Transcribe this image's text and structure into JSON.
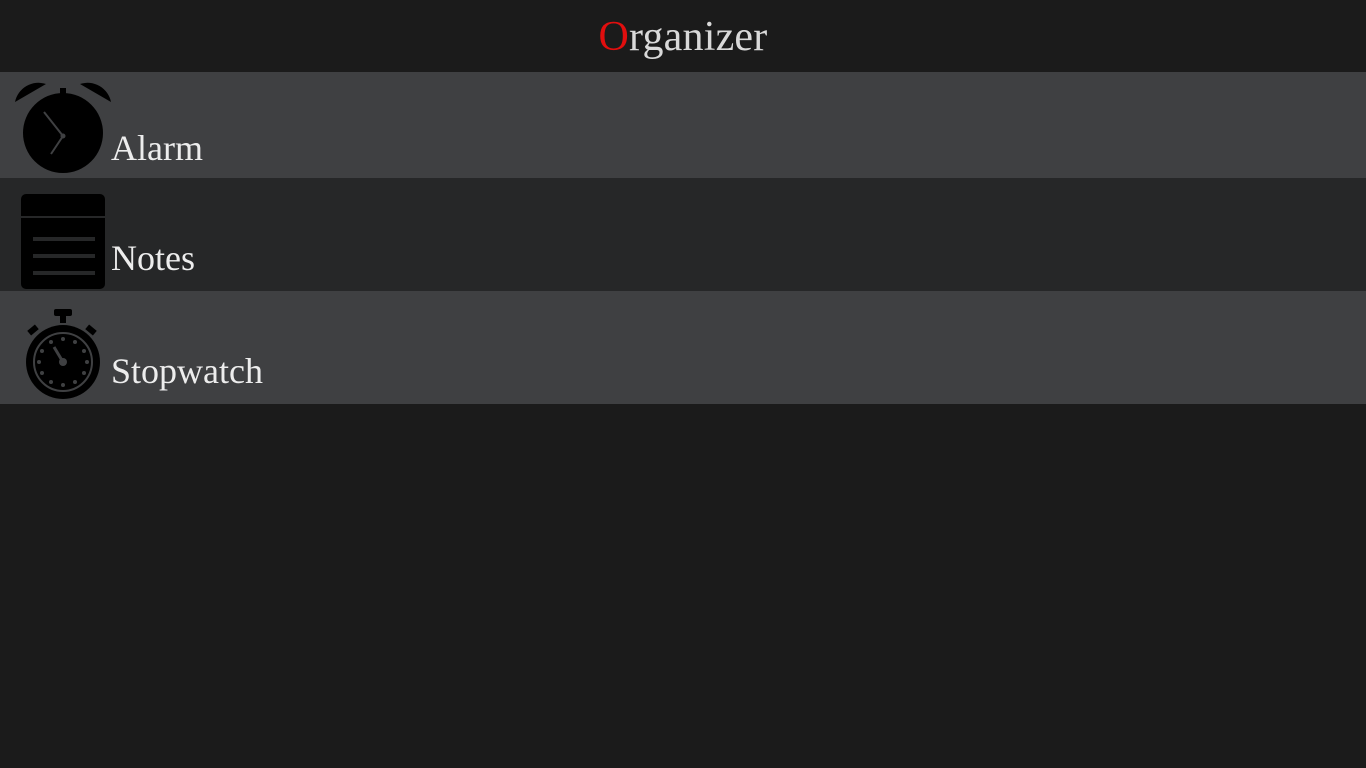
{
  "header": {
    "title_first_letter": "O",
    "title_rest": "rganizer"
  },
  "menu": {
    "items": [
      {
        "label": "Alarm",
        "icon": "alarm-clock-icon"
      },
      {
        "label": "Notes",
        "icon": "notes-icon"
      },
      {
        "label": "Stopwatch",
        "icon": "stopwatch-icon"
      }
    ]
  },
  "colors": {
    "background": "#1b1b1b",
    "row_light": "#3f4042",
    "row_dark": "#262728",
    "accent": "#e10e0e",
    "text": "#ededed"
  }
}
